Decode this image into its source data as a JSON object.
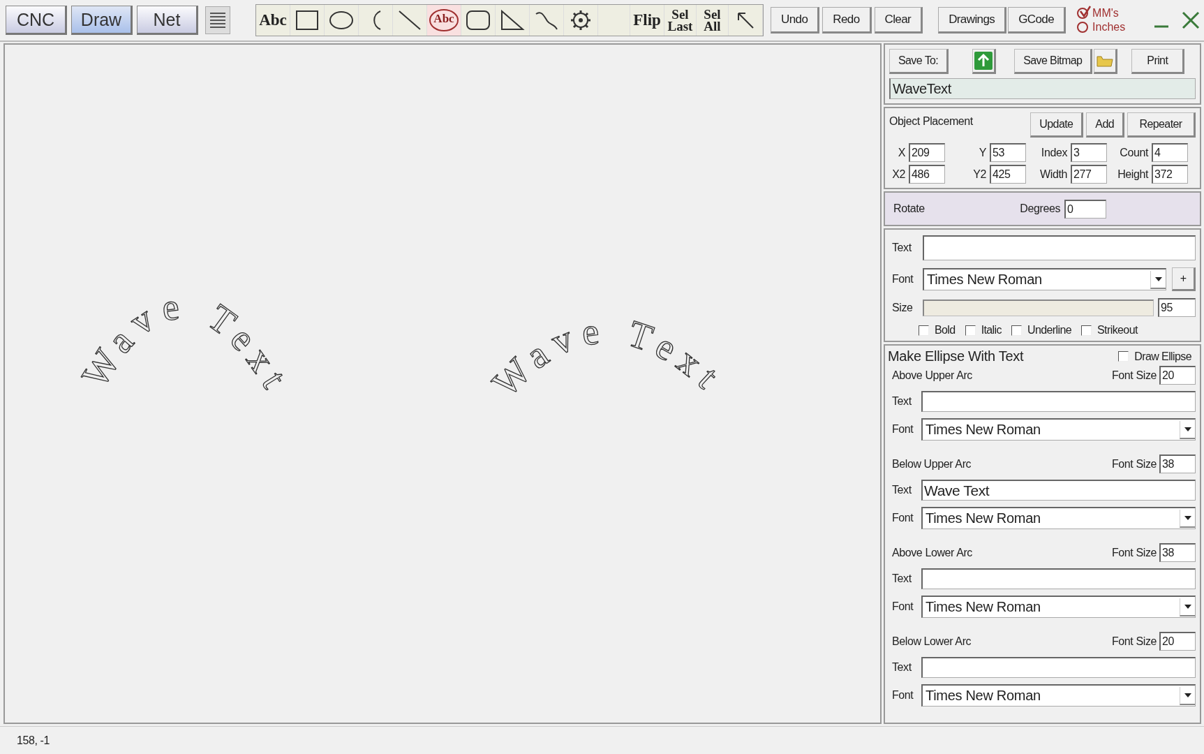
{
  "mode_tabs": [
    {
      "label": "CNC",
      "selected": false
    },
    {
      "label": "Draw",
      "selected": true
    },
    {
      "label": "Net",
      "selected": false
    }
  ],
  "tools": [
    {
      "kind": "label",
      "label": "Abc",
      "selected": false
    },
    {
      "kind": "rectangle",
      "selected": false
    },
    {
      "kind": "ellipse",
      "selected": false
    },
    {
      "kind": "arc",
      "selected": false
    },
    {
      "kind": "line",
      "selected": false
    },
    {
      "kind": "ellipse_text",
      "label": "Abc",
      "selected": true
    },
    {
      "kind": "rounded_rectangle",
      "selected": false
    },
    {
      "kind": "triangle",
      "selected": false
    },
    {
      "kind": "curve",
      "selected": false
    },
    {
      "kind": "gear",
      "selected": false
    },
    {
      "kind": "blank",
      "selected": false
    },
    {
      "kind": "label",
      "label": "Flip",
      "selected": false
    },
    {
      "kind": "stacked",
      "label": "Sel Last",
      "selected": false
    },
    {
      "kind": "stacked",
      "label": "Sel All",
      "selected": false
    },
    {
      "kind": "pointer",
      "selected": false
    }
  ],
  "edit_buttons": [
    "Undo",
    "Redo",
    "Clear"
  ],
  "view_buttons": [
    "Drawings",
    "GCode"
  ],
  "units": [
    {
      "label": "MM's",
      "selected": true
    },
    {
      "label": "Inches",
      "selected": false
    }
  ],
  "canvas": {
    "objects": [
      {
        "text": "Wave Text"
      },
      {
        "text": "Wave Text"
      }
    ]
  },
  "save": {
    "save_to": "Save To:",
    "save_bitmap": "Save Bitmap",
    "print": "Print",
    "file_name": "WaveText"
  },
  "placement": {
    "title": "Object Placement",
    "buttons": [
      "Update",
      "Add",
      "Repeater"
    ],
    "fields": [
      {
        "label": "X",
        "value": "209"
      },
      {
        "label": "Y",
        "value": "53"
      },
      {
        "label": "Index",
        "value": "3"
      },
      {
        "label": "Count",
        "value": "4"
      },
      {
        "label": "X2",
        "value": "486"
      },
      {
        "label": "Y2",
        "value": "425"
      },
      {
        "label": "Width",
        "value": "277"
      },
      {
        "label": "Height",
        "value": "372"
      }
    ]
  },
  "rotate": {
    "label": "Rotate",
    "degrees_label": "Degrees",
    "degrees": "0"
  },
  "text_props": {
    "text_label": "Text",
    "font_label": "Font",
    "font": "Times New Roman",
    "add_button": "+",
    "size_label": "Size",
    "size": "95",
    "styles": [
      {
        "label": "Bold",
        "checked": false
      },
      {
        "label": "Italic",
        "checked": false
      },
      {
        "label": "Underline",
        "checked": false
      },
      {
        "label": "Strikeout",
        "checked": false
      }
    ]
  },
  "ellipse": {
    "title": "Make Ellipse With Text",
    "draw_ellipse": {
      "label": "Draw Ellipse",
      "checked": false
    },
    "arcs": [
      {
        "name": "Above Upper Arc",
        "font_size_label": "Font Size",
        "font_size": "20",
        "text_label": "Text",
        "font_label": "Font",
        "font": "Times New Roman"
      },
      {
        "name": "Below Upper Arc",
        "font_size_label": "Font Size",
        "font_size": "38",
        "text_label": "Text",
        "text": "Wave Text",
        "font_label": "Font",
        "font": "Times New Roman"
      },
      {
        "name": "Above Lower Arc",
        "font_size_label": "Font Size",
        "font_size": "38",
        "text_label": "Text",
        "font_label": "Font",
        "font": "Times New Roman"
      },
      {
        "name": "Below Lower Arc",
        "font_size_label": "Font Size",
        "font_size": "20",
        "text_label": "Text",
        "font_label": "Font",
        "font": "Times New Roman"
      }
    ]
  },
  "status_bar": {
    "coordinates": "158, -1"
  }
}
